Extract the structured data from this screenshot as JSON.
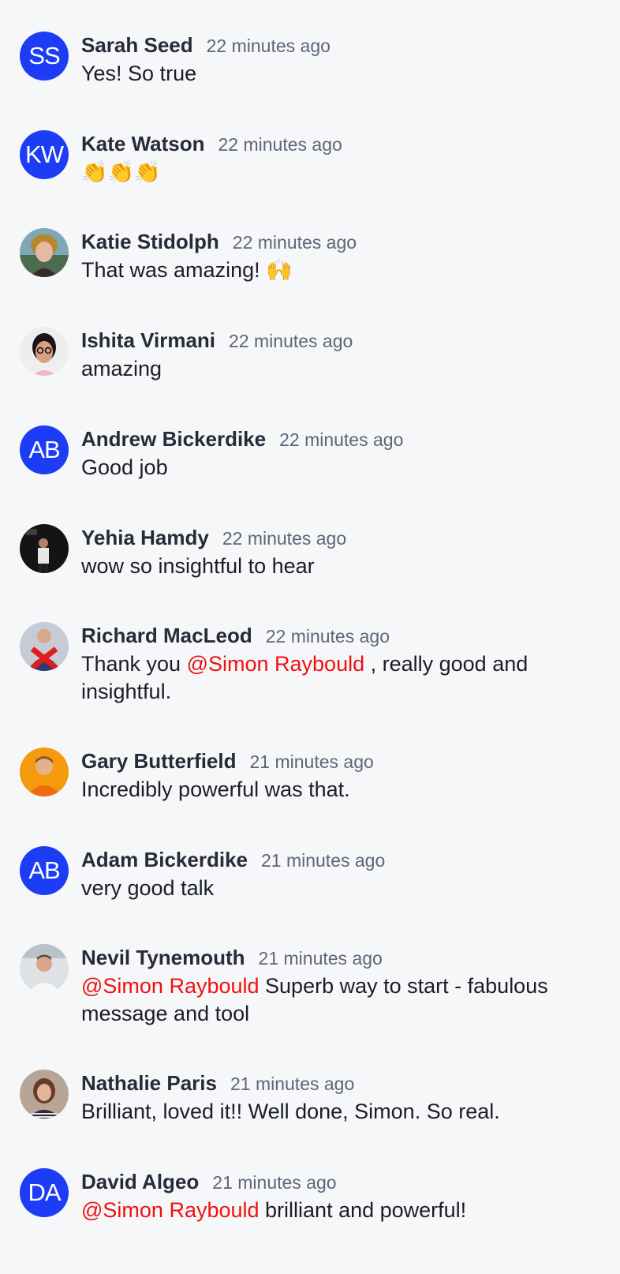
{
  "messages": [
    {
      "author": "Sarah Seed",
      "time": "22 minutes ago",
      "avatar": {
        "type": "initials",
        "text": "SS"
      },
      "text": "Yes! So true"
    },
    {
      "author": "Kate Watson",
      "time": "22 minutes ago",
      "avatar": {
        "type": "initials",
        "text": "KW"
      },
      "text": "👏👏👏"
    },
    {
      "author": "Katie Stidolph",
      "time": "22 minutes ago",
      "avatar": {
        "type": "photo"
      },
      "text": "That was amazing! 🙌"
    },
    {
      "author": "Ishita Virmani",
      "time": "22 minutes ago",
      "avatar": {
        "type": "photo"
      },
      "text": "amazing"
    },
    {
      "author": "Andrew Bickerdike",
      "time": "22 minutes ago",
      "avatar": {
        "type": "initials",
        "text": "AB"
      },
      "text": "Good job"
    },
    {
      "author": "Yehia Hamdy",
      "time": "22 minutes ago",
      "avatar": {
        "type": "photo"
      },
      "text": "wow so insightful to hear"
    },
    {
      "author": "Richard MacLeod",
      "time": "22 minutes ago",
      "avatar": {
        "type": "photo"
      },
      "pre": "Thank you ",
      "mention": "@Simon Raybould",
      "post": " , really good and insightful."
    },
    {
      "author": "Gary Butterfield",
      "time": "21 minutes ago",
      "avatar": {
        "type": "photo"
      },
      "text": "Incredibly powerful was that."
    },
    {
      "author": "Adam Bickerdike",
      "time": "21 minutes ago",
      "avatar": {
        "type": "initials",
        "text": "AB"
      },
      "text": "very good talk"
    },
    {
      "author": "Nevil Tynemouth",
      "time": "21 minutes ago",
      "avatar": {
        "type": "photo"
      },
      "pre": "",
      "mention": "@Simon Raybould",
      "post": " Superb way to start - fabulous message and tool"
    },
    {
      "author": "Nathalie Paris",
      "time": "21 minutes ago",
      "avatar": {
        "type": "photo"
      },
      "text": "Brilliant, loved it!! Well done, Simon. So real."
    },
    {
      "author": "David Algeo",
      "time": "21 minutes ago",
      "avatar": {
        "type": "initials",
        "text": "DA"
      },
      "pre": "",
      "mention": "@Simon Raybould",
      "post": " brilliant and powerful!"
    }
  ],
  "colors": {
    "avatar_bg": "#1c3cf5",
    "mention": "#f01010",
    "name": "#272a38",
    "time": "#5f6577"
  }
}
